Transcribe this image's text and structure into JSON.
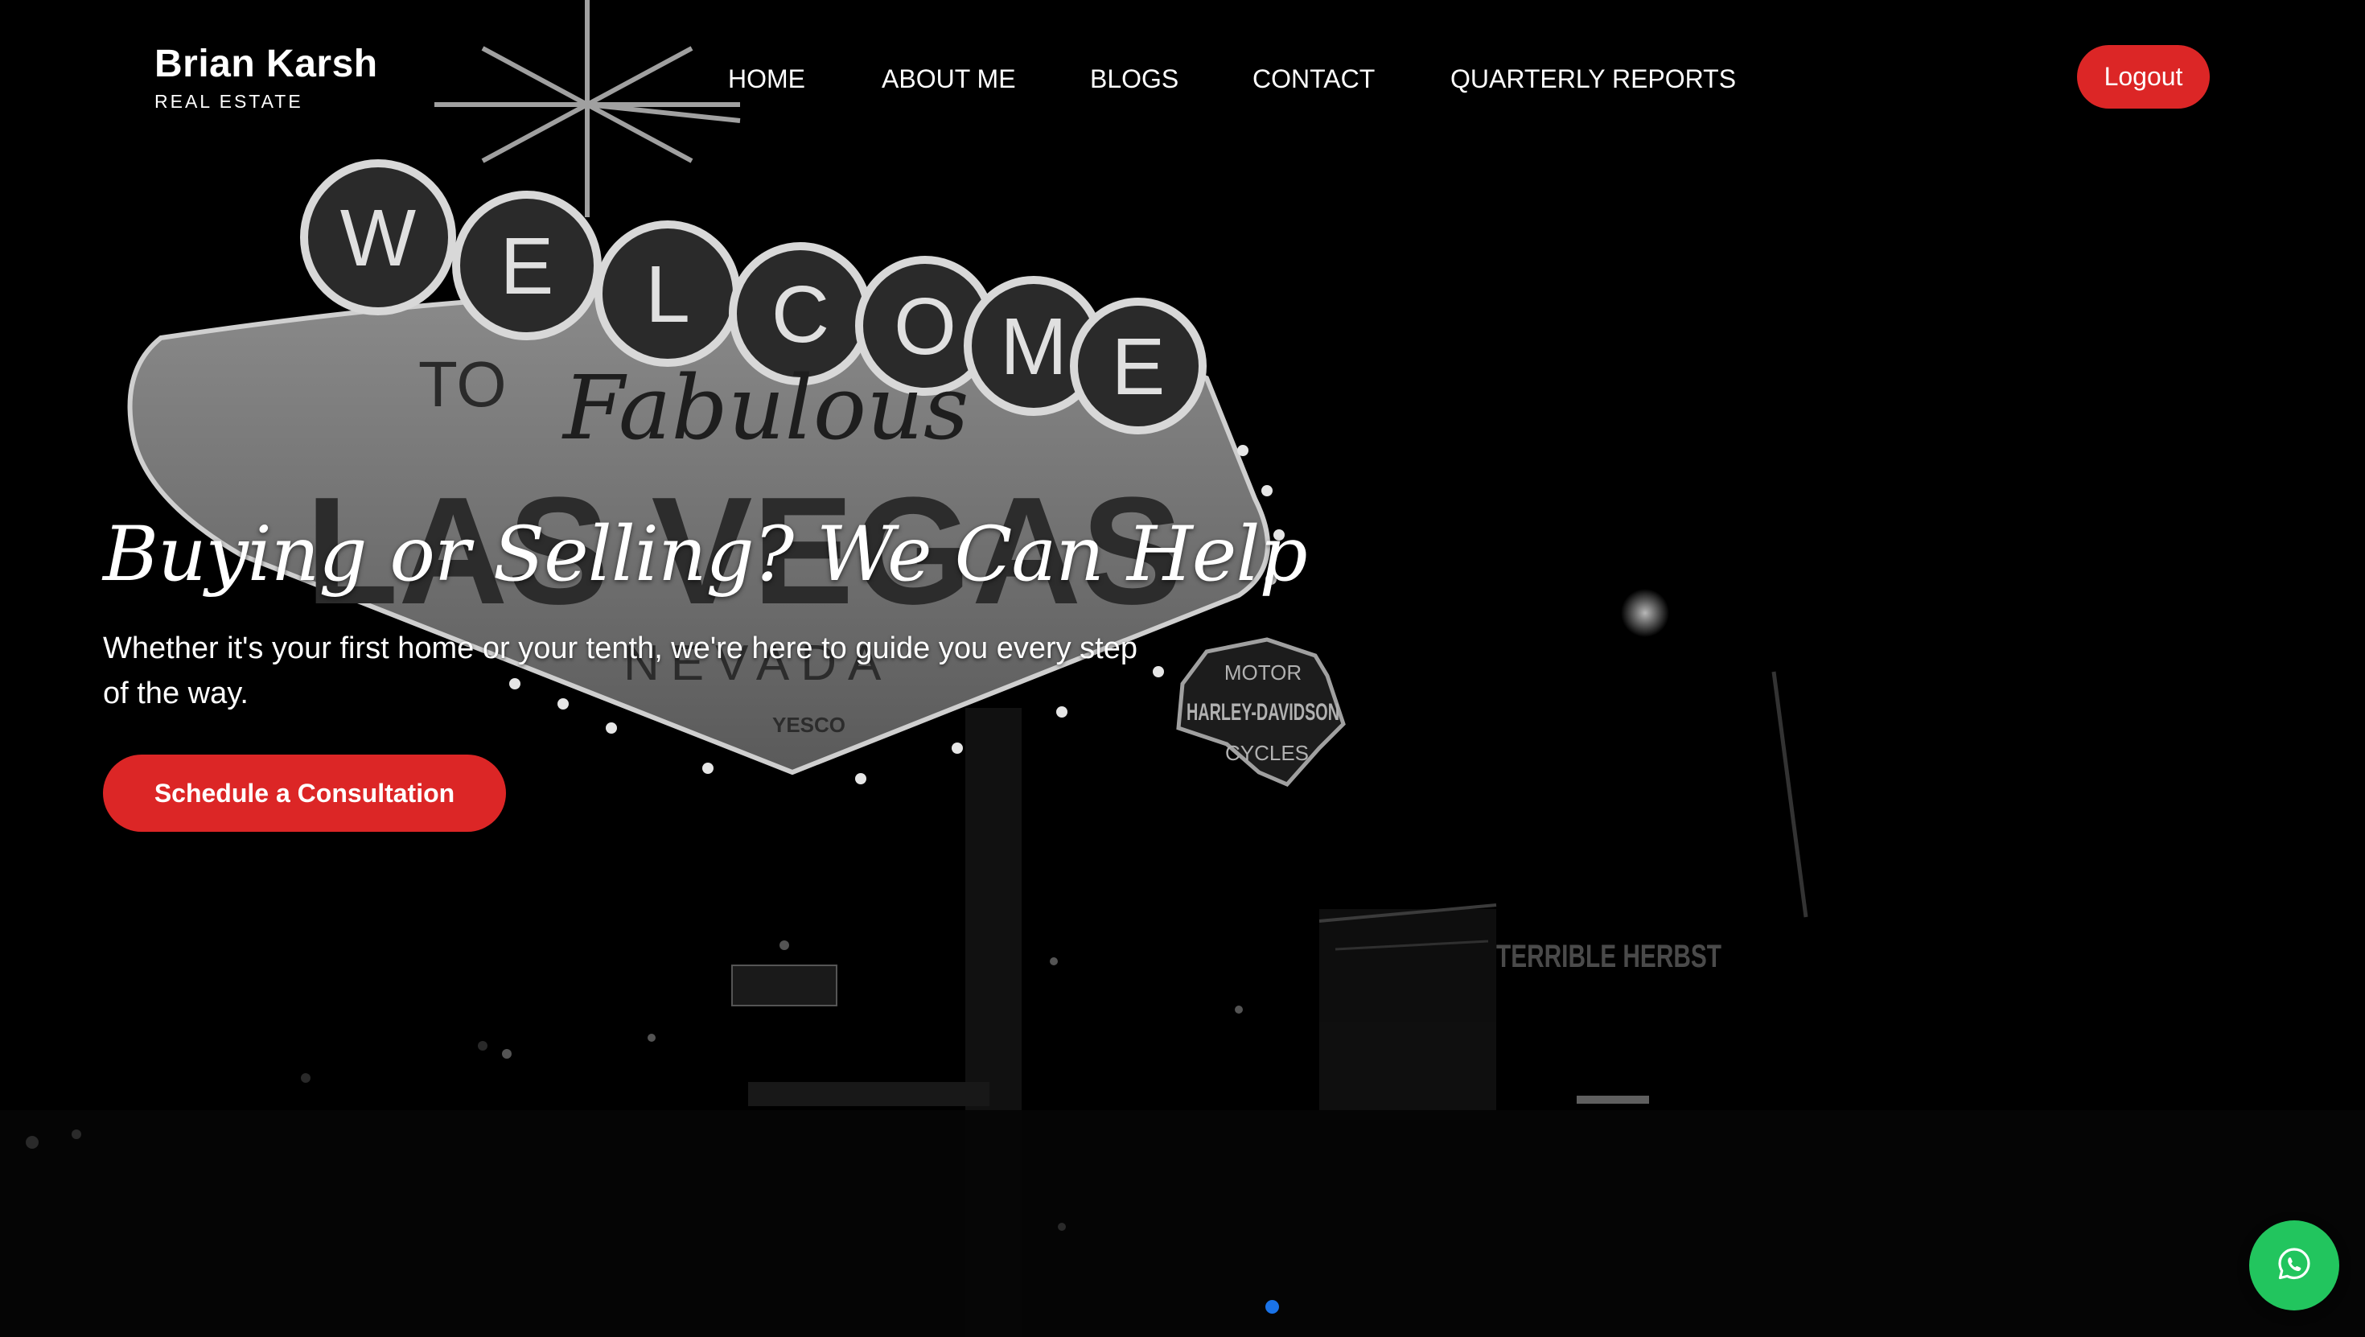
{
  "brand": {
    "name": "Brian Karsh",
    "tagline": "REAL ESTATE"
  },
  "nav": {
    "items": [
      {
        "label": "HOME"
      },
      {
        "label": "ABOUT ME"
      },
      {
        "label": "BLOGS"
      },
      {
        "label": "CONTACT"
      },
      {
        "label": "QUARTERLY REPORTS"
      }
    ],
    "logout_label": "Logout"
  },
  "hero": {
    "heading": "Buying or Selling? We Can Help",
    "subtext": "Whether it's your first home or your tenth, we're here to guide you every step of the way.",
    "cta_label": "Schedule a Consultation",
    "background": {
      "sign_arch_letters": [
        "W",
        "E",
        "L",
        "C",
        "O",
        "M",
        "E"
      ],
      "sign_to": "TO",
      "sign_fabulous": "Fabulous",
      "sign_city": "LAS VEGAS",
      "sign_state": "NEVADA",
      "sign_maker": "YESCO",
      "badge_top": "MOTOR",
      "badge_mid": "HARLEY-DAVIDSON",
      "badge_bottom": "CYCLES",
      "casino_sign": "TERRIBLE HERBST"
    }
  },
  "slider": {
    "active_index": 0,
    "count": 1
  },
  "floating": {
    "icon": "whatsapp-icon"
  },
  "colors": {
    "accent": "#dc2626",
    "whatsapp": "#22c55e",
    "slider_dot": "#1a73e8",
    "background": "#000000"
  }
}
